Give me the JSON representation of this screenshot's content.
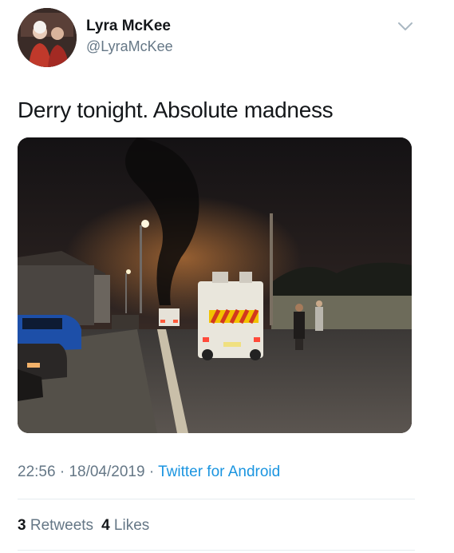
{
  "author": {
    "name": "Lyra McKee",
    "handle": "@LyraMcKee"
  },
  "tweet": {
    "text": "Derry tonight. Absolute madness"
  },
  "meta": {
    "time": "22:56",
    "separator": "·",
    "date": "18/04/2019",
    "source": "Twitter for Android"
  },
  "stats": {
    "retweets_count": "3",
    "retweets_label": "Retweets",
    "likes_count": "4",
    "likes_label": "Likes"
  },
  "icons": {
    "menu": "chevron-down-icon"
  },
  "colors": {
    "link": "#1b95e0",
    "secondary_text": "#657786",
    "primary_text": "#14171a",
    "divider": "#e6ecf0"
  }
}
